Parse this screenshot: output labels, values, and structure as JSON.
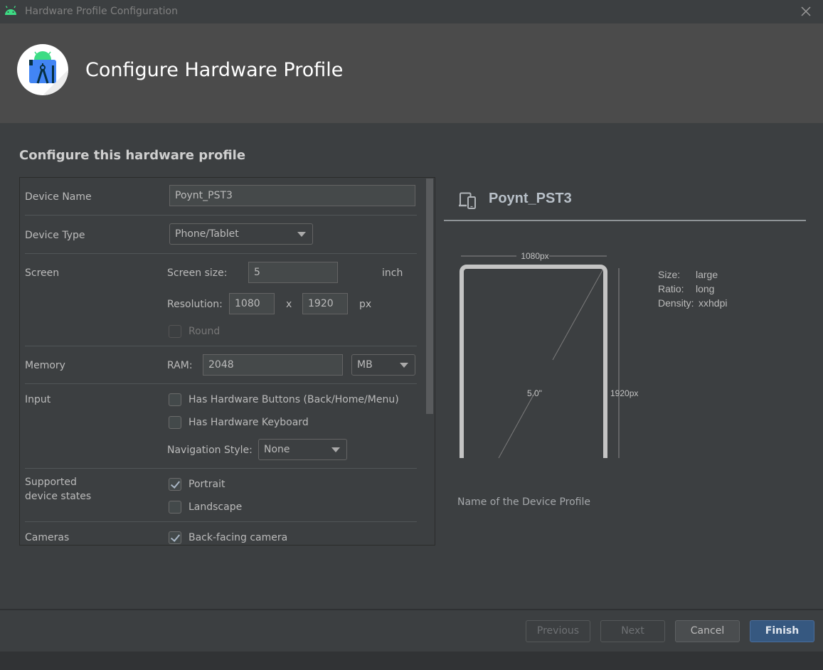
{
  "window": {
    "title": "Hardware Profile Configuration",
    "close_icon": "close-icon",
    "app_icon": "android-icon"
  },
  "header": {
    "title": "Configure Hardware Profile",
    "logo_icon": "android-studio-logo-icon"
  },
  "main": {
    "section_title": "Configure this hardware profile"
  },
  "form": {
    "device_name": {
      "label": "Device Name",
      "value": "Poynt_PST3"
    },
    "device_type": {
      "label": "Device Type",
      "value": "Phone/Tablet"
    },
    "screen": {
      "label": "Screen",
      "size_label": "Screen size:",
      "size_value": "5",
      "size_unit": "inch",
      "resolution_label": "Resolution:",
      "res_width": "1080",
      "res_sep": "x",
      "res_height": "1920",
      "res_unit": "px",
      "round_label": "Round",
      "round_checked": false
    },
    "memory": {
      "label": "Memory",
      "ram_label": "RAM:",
      "ram_value": "2048",
      "ram_unit": "MB"
    },
    "input": {
      "label": "Input",
      "hw_buttons_label": "Has Hardware Buttons (Back/Home/Menu)",
      "hw_buttons_checked": false,
      "hw_keyboard_label": "Has Hardware Keyboard",
      "hw_keyboard_checked": false,
      "nav_style_label": "Navigation Style:",
      "nav_style_value": "None"
    },
    "device_states": {
      "label_line1": "Supported",
      "label_line2": "device states",
      "portrait_label": "Portrait",
      "portrait_checked": true,
      "landscape_label": "Landscape",
      "landscape_checked": false
    },
    "cameras": {
      "label": "Cameras",
      "back_camera_label": "Back-facing camera",
      "back_camera_checked": true
    }
  },
  "preview": {
    "device_icon": "phone-tablet-icon",
    "device_name": "Poynt_PST3",
    "width_label": "1080px",
    "height_label": "1920px",
    "diagonal_label": "5.0\"",
    "specs": [
      {
        "key": "Size:",
        "value": "large"
      },
      {
        "key": "Ratio:",
        "value": "long"
      },
      {
        "key": "Density:",
        "value": "xxhdpi"
      }
    ],
    "description": "Name of the Device Profile"
  },
  "footer": {
    "previous_label": "Previous",
    "next_label": "Next",
    "cancel_label": "Cancel",
    "finish_label": "Finish"
  },
  "colors": {
    "accent_primary_button": "#365880",
    "android_green": "#3ddc84",
    "studio_blue": "#4285f4"
  }
}
